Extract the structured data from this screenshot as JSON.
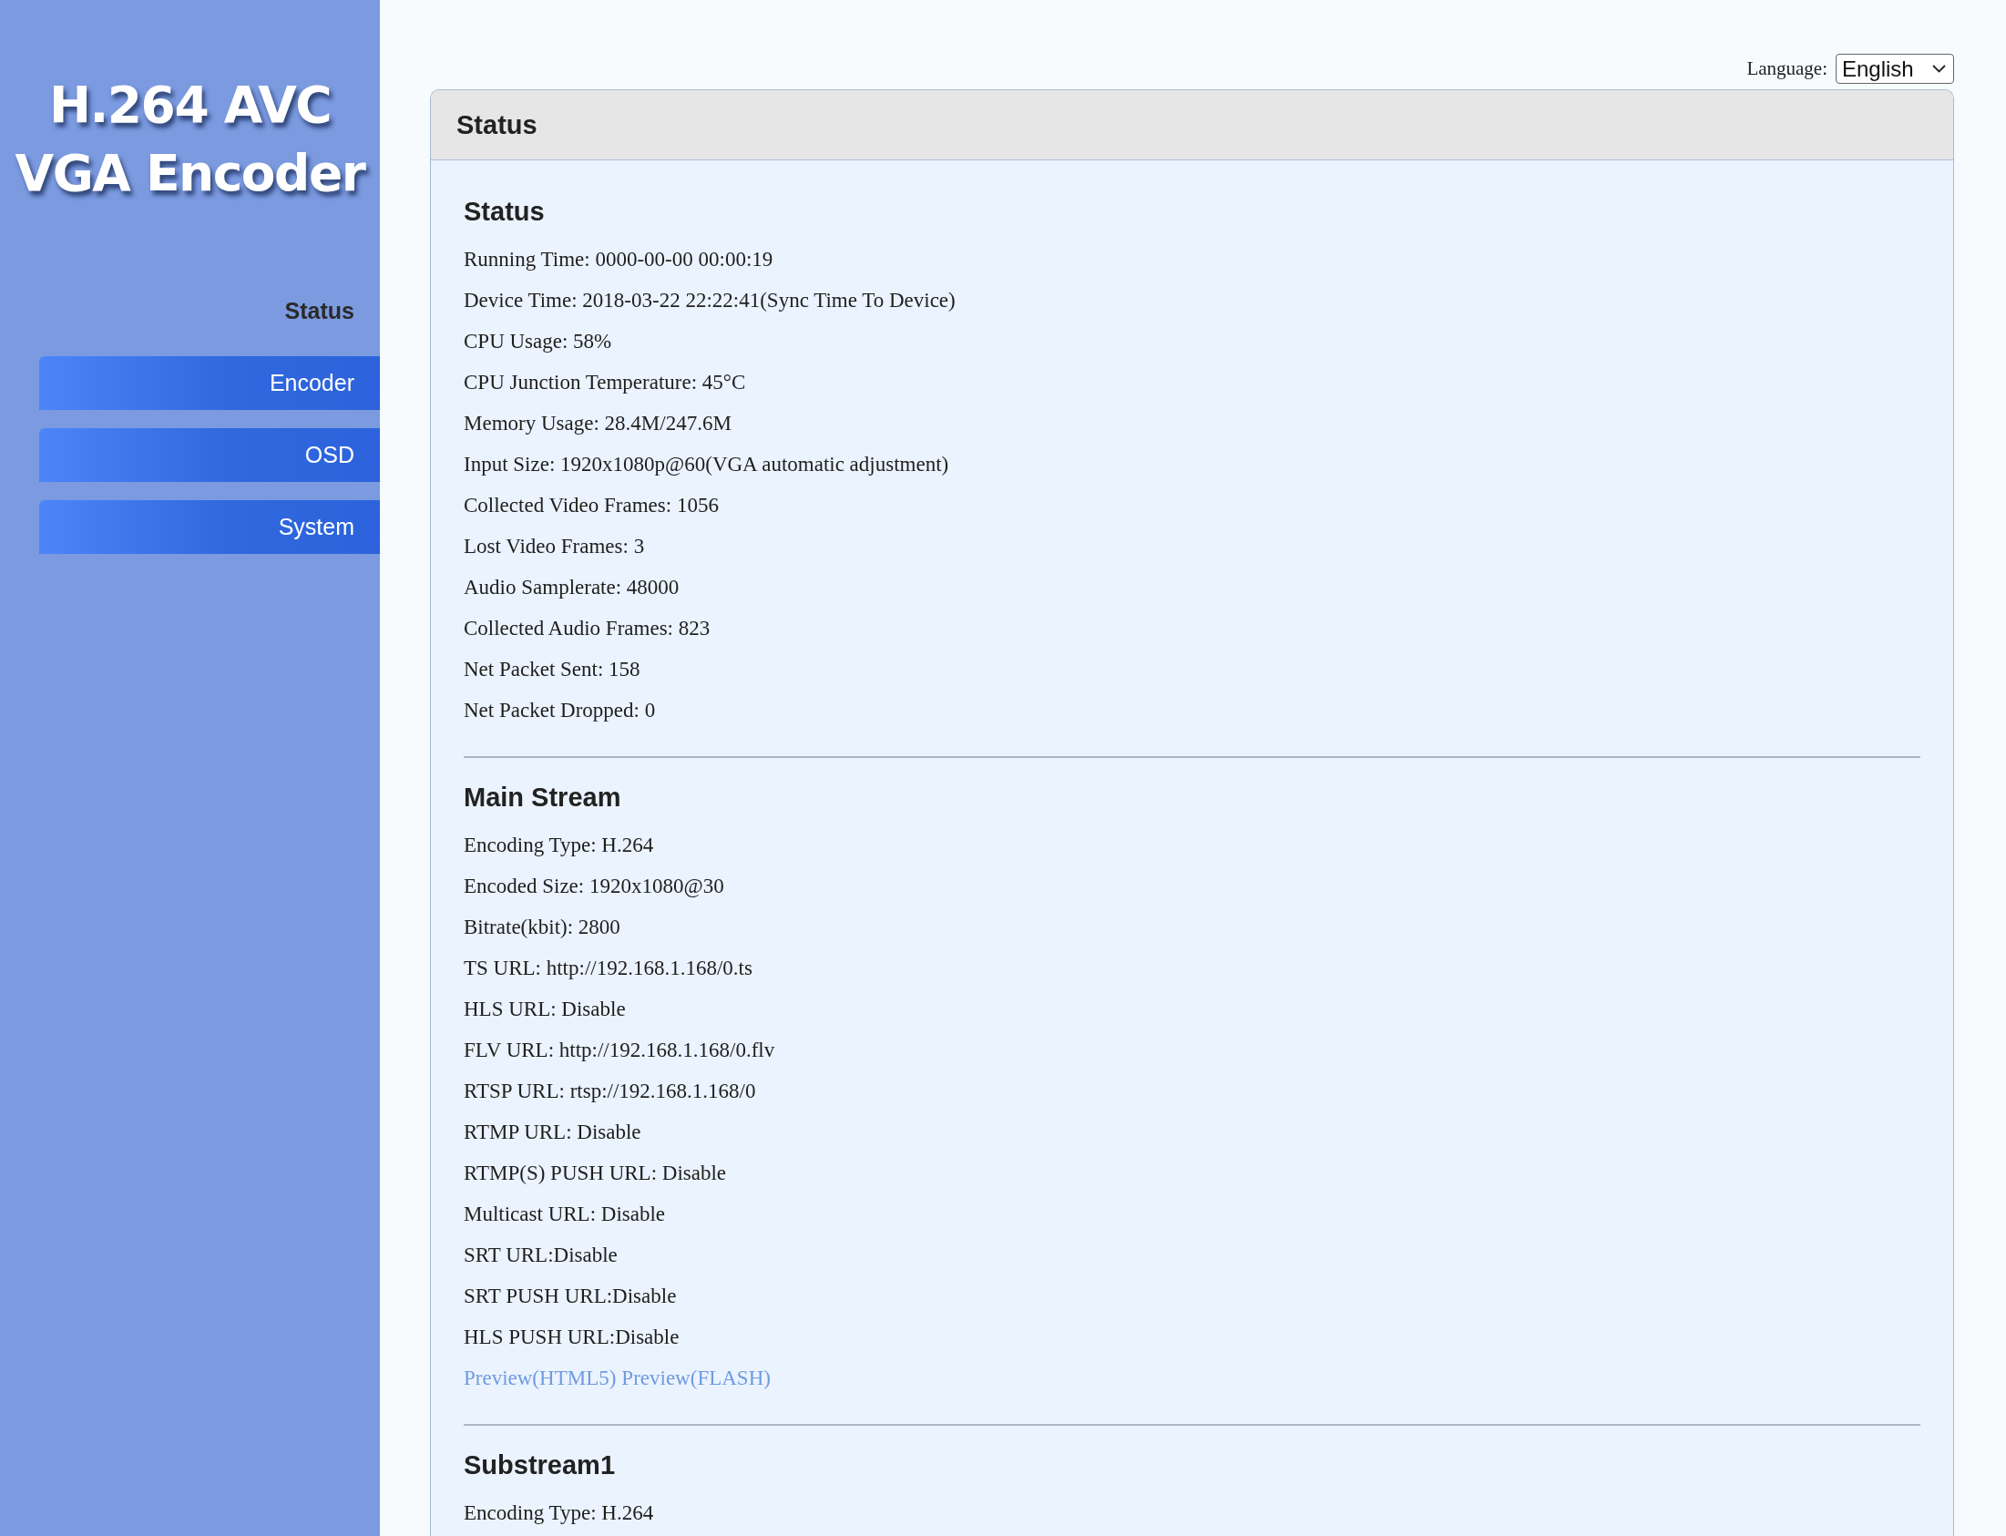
{
  "sidebar": {
    "logo_lines": [
      "H.264 AVC",
      "VGA Encoder"
    ],
    "items": [
      {
        "label": "Status",
        "selected": true
      },
      {
        "label": "Encoder",
        "selected": false
      },
      {
        "label": "OSD",
        "selected": false
      },
      {
        "label": "System",
        "selected": false
      }
    ]
  },
  "language": {
    "label": "Language:",
    "value": "English"
  },
  "panel": {
    "title": "Status",
    "sections": [
      {
        "heading": "Status",
        "lines": [
          "Running Time: 0000-00-00 00:00:19",
          "Device Time: 2018-03-22 22:22:41(Sync Time To Device)",
          "CPU Usage: 58%",
          "CPU Junction Temperature: 45°C",
          "Memory Usage: 28.4M/247.6M",
          "Input Size: 1920x1080p@60(VGA automatic adjustment)",
          "Collected Video Frames: 1056",
          "Lost Video Frames: 3",
          "Audio Samplerate: 48000",
          "Collected Audio Frames: 823",
          "Net Packet Sent: 158",
          "Net Packet Dropped: 0"
        ]
      },
      {
        "heading": "Main Stream",
        "lines": [
          "Encoding Type: H.264",
          "Encoded Size: 1920x1080@30",
          "Bitrate(kbit): 2800",
          "TS URL: http://192.168.1.168/0.ts",
          "HLS URL: Disable",
          "FLV URL: http://192.168.1.168/0.flv",
          "RTSP URL: rtsp://192.168.1.168/0",
          "RTMP URL: Disable",
          "RTMP(S) PUSH URL: Disable",
          "Multicast URL: Disable",
          "SRT URL:Disable",
          "SRT PUSH URL:Disable",
          "HLS PUSH URL:Disable"
        ],
        "links": [
          "Preview(HTML5)",
          "Preview(FLASH)"
        ]
      },
      {
        "heading": "Substream1",
        "lines": [
          "Encoding Type: H.264"
        ]
      }
    ]
  }
}
